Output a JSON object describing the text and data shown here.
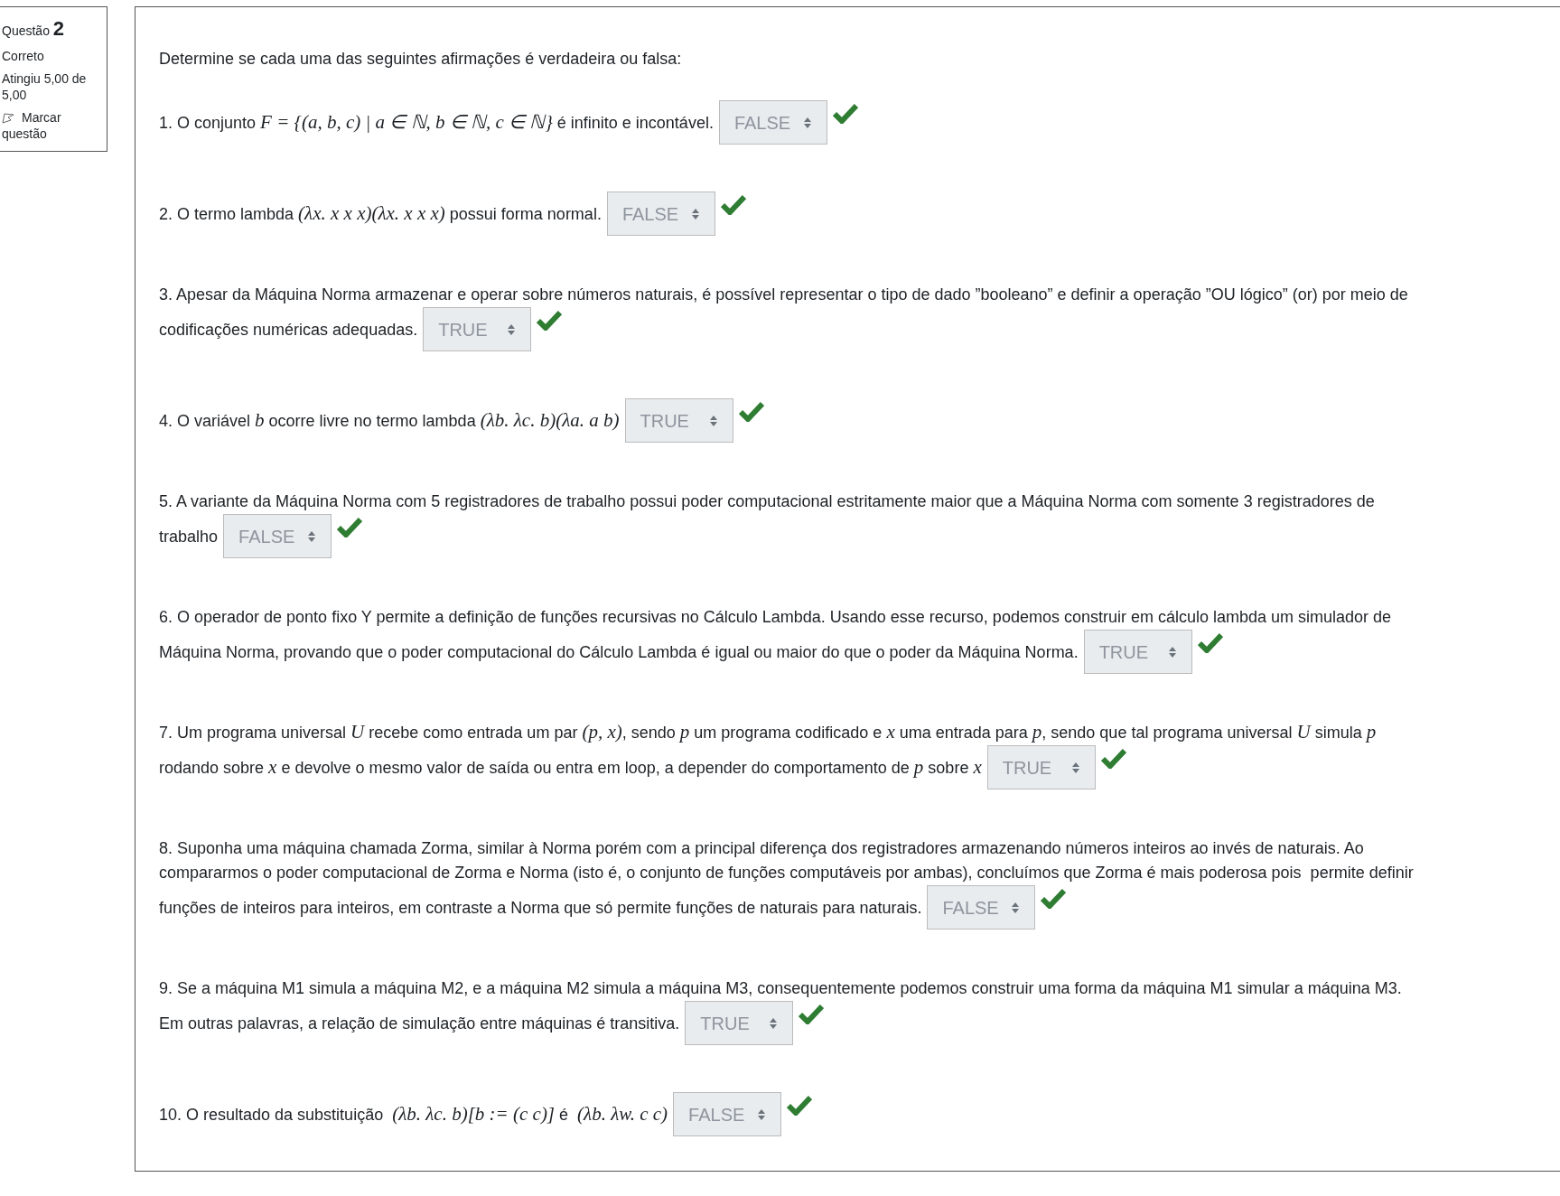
{
  "question_info": {
    "label": "Questão",
    "number": "2",
    "status": "Correto",
    "grade": "Atingiu 5,00 de 5,00",
    "flag": "Marcar questão"
  },
  "instruction": "Determine se cada uma das seguintes afirmações  é verdadeira ou falsa:",
  "statements": [
    {
      "lines": [
        [
          {
            "kind": "text",
            "text": "1. O conjunto "
          },
          {
            "kind": "math",
            "text": "F = {(a, b, c) | a ∈ ℕ, b ∈ ℕ, c ∈ ℕ}"
          },
          {
            "kind": "text",
            "text": " é infinito e incontável."
          }
        ]
      ],
      "answer": "FALSE",
      "correct": true
    },
    {
      "lines": [
        [
          {
            "kind": "text",
            "text": "2. O termo lambda "
          },
          {
            "kind": "math",
            "text": "(λx. x x x)(λx. x x x)"
          },
          {
            "kind": "text",
            "text": " possui forma normal."
          }
        ]
      ],
      "answer": "FALSE",
      "correct": true
    },
    {
      "lines": [
        [
          {
            "kind": "text",
            "text": "3. Apesar da Máquina Norma armazenar e operar sobre números naturais, é possível representar o tipo de dado ”booleano” e definir a operação ”OU lógico” (or) por meio de"
          }
        ],
        [
          {
            "kind": "text",
            "text": "codificações numéricas adequadas."
          }
        ]
      ],
      "answer": "TRUE",
      "correct": true
    },
    {
      "lines": [
        [
          {
            "kind": "text",
            "text": "4. O variável "
          },
          {
            "kind": "math",
            "text": "b"
          },
          {
            "kind": "text",
            "text": " ocorre livre no termo lambda "
          },
          {
            "kind": "math",
            "text": "(λb. λc. b)(λa. a b)"
          }
        ]
      ],
      "answer": "TRUE",
      "correct": true
    },
    {
      "lines": [
        [
          {
            "kind": "text",
            "text": "5. A variante da Máquina Norma com 5 registradores de trabalho possui poder computacional estritamente maior que a Máquina Norma com somente 3 registradores de"
          }
        ],
        [
          {
            "kind": "text",
            "text": "trabalho"
          }
        ]
      ],
      "answer": "FALSE",
      "correct": true
    },
    {
      "lines": [
        [
          {
            "kind": "text",
            "text": "6. O operador de ponto fixo Y permite a definição de funções recursivas no Cálculo Lambda. Usando esse recurso, podemos construir em cálculo lambda um simulador de"
          }
        ],
        [
          {
            "kind": "text",
            "text": "Máquina Norma, provando que o poder computacional do Cálculo Lambda é igual ou maior do que o poder da Máquina Norma."
          }
        ]
      ],
      "answer": "TRUE",
      "correct": true
    },
    {
      "lines": [
        [
          {
            "kind": "text",
            "text": "7. Um programa universal "
          },
          {
            "kind": "math",
            "text": "U"
          },
          {
            "kind": "text",
            "text": " recebe como entrada um par "
          },
          {
            "kind": "math",
            "text": "(p, x)"
          },
          {
            "kind": "text",
            "text": ", sendo "
          },
          {
            "kind": "math",
            "text": "p"
          },
          {
            "kind": "text",
            "text": " um programa codificado e "
          },
          {
            "kind": "math",
            "text": "x"
          },
          {
            "kind": "text",
            "text": " uma entrada para "
          },
          {
            "kind": "math",
            "text": "p"
          },
          {
            "kind": "text",
            "text": ", sendo que tal programa universal "
          },
          {
            "kind": "math",
            "text": "U"
          },
          {
            "kind": "text",
            "text": " simula "
          },
          {
            "kind": "math",
            "text": "p"
          }
        ],
        [
          {
            "kind": "text",
            "text": "rodando sobre "
          },
          {
            "kind": "math",
            "text": "x"
          },
          {
            "kind": "text",
            "text": " e devolve o mesmo valor de saída ou entra em loop, a depender do comportamento de "
          },
          {
            "kind": "math",
            "text": "p"
          },
          {
            "kind": "text",
            "text": " sobre "
          },
          {
            "kind": "math",
            "text": "x"
          }
        ]
      ],
      "answer": "TRUE",
      "correct": true
    },
    {
      "lines": [
        [
          {
            "kind": "text",
            "text": "8. Suponha uma máquina chamada Zorma, similar à Norma porém com a principal diferença dos registradores armazenando números inteiros ao invés de naturais. Ao"
          }
        ],
        [
          {
            "kind": "text",
            "text": "compararmos o poder computacional de Zorma e Norma (isto é, o conjunto de funções computáveis por ambas), concluímos que Zorma é mais poderosa pois  permite definir"
          }
        ],
        [
          {
            "kind": "text",
            "text": "funções de inteiros para inteiros, em contraste a Norma que só permite funções de naturais para naturais."
          }
        ]
      ],
      "answer": "FALSE",
      "correct": true
    },
    {
      "lines": [
        [
          {
            "kind": "text",
            "text": "9. Se a máquina M1 simula a máquina M2, e a máquina M2 simula a máquina M3, consequentemente podemos construir uma forma da máquina M1 simular a máquina M3."
          }
        ],
        [
          {
            "kind": "text",
            "text": "Em outras palavras, a relação de simulação entre máquinas é transitiva."
          }
        ]
      ],
      "answer": "TRUE",
      "correct": true
    },
    {
      "lines": [
        [
          {
            "kind": "text",
            "text": "10. O resultado da substituição  "
          },
          {
            "kind": "math",
            "text": "(λb. λc. b)[b := (c c)]"
          },
          {
            "kind": "text",
            "text": " é  "
          },
          {
            "kind": "math",
            "text": "(λb. λw. c c)"
          }
        ]
      ],
      "answer": "FALSE",
      "correct": true
    }
  ]
}
